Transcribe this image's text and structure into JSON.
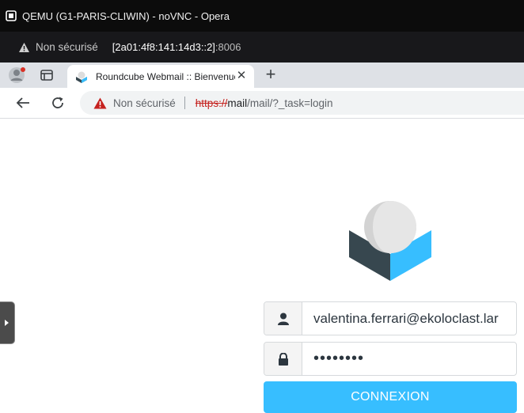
{
  "window": {
    "title": "QEMU (G1-PARIS-CLIWIN) - noVNC - Opera"
  },
  "outer_address_bar": {
    "security_label": "Non sécurisé",
    "host": "[2a01:4f8:141:14d3::2]",
    "port": ":8006"
  },
  "browser": {
    "tab": {
      "title": "Roundcube Webmail :: Bienvenue",
      "close_icon": "close-icon"
    },
    "new_tab_symbol": "+",
    "omnibox": {
      "security_label": "Non sécurisé",
      "url_scheme": "https://",
      "url_host": "mail",
      "url_path": "/mail/?_task=login"
    }
  },
  "login": {
    "username_value": "valentina.ferrari@ekoloclast.lar",
    "password_masked": "••••••••",
    "submit_label": "CONNEXION"
  },
  "colors": {
    "accent": "#37beff",
    "logo_dark": "#37474f",
    "logo_blue": "#37beff",
    "logo_sphere": "#dddddd",
    "warning_red": "#c5221f"
  }
}
